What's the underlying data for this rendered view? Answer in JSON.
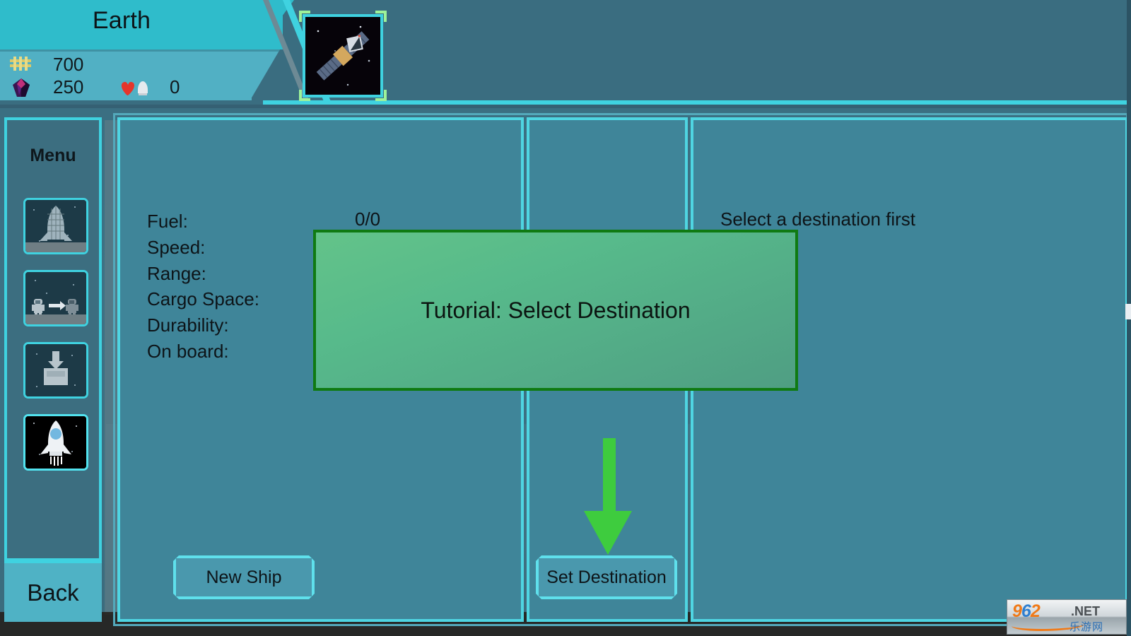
{
  "header": {
    "planet_name": "Earth",
    "resources": [
      {
        "icon": "coins-icon",
        "value": "700"
      },
      {
        "icon": "gem-icon",
        "value": "250"
      },
      {
        "icon": "heart-rocket-icon",
        "value": "0"
      }
    ],
    "thumbnail": {
      "name": "satellite-thumbnail",
      "label": "Satellite"
    }
  },
  "sidebar": {
    "title": "Menu",
    "items": [
      {
        "name": "sidebar-item-shuttle",
        "icon": "shuttle-on-pad-icon",
        "active": false
      },
      {
        "name": "sidebar-item-crew-transfer",
        "icon": "astronaut-transfer-icon",
        "active": false
      },
      {
        "name": "sidebar-item-cargo-load",
        "icon": "load-cargo-icon",
        "active": false
      },
      {
        "name": "sidebar-item-launch",
        "icon": "rocket-icon",
        "active": true
      }
    ],
    "back_label": "Back"
  },
  "main": {
    "stats": [
      {
        "label": "Fuel:",
        "value": "0/0"
      },
      {
        "label": "Speed:",
        "value": ""
      },
      {
        "label": "Range:",
        "value": ""
      },
      {
        "label": "Cargo Space:",
        "value": ""
      },
      {
        "label": "Durability:",
        "value": ""
      },
      {
        "label": "On board:",
        "value": ""
      }
    ],
    "fuel_value": "0/0",
    "destination_message": "Select a destination first",
    "new_ship_label": "New Ship",
    "set_destination_label": "Set Destination"
  },
  "tutorial": {
    "text": "Tutorial: Select Destination",
    "arrow": "down-arrow-icon",
    "border_color": "#0f7a12",
    "fill_color": "#57ba8b"
  },
  "colors": {
    "accent_cyan": "#3fd2e0",
    "panel_bg": "#3f8599",
    "header_cyan": "#2fbccb",
    "arrow_green": "#3ecc3e"
  },
  "watermark": {
    "num": "962",
    "net": ".NET",
    "cn": "乐游网"
  }
}
